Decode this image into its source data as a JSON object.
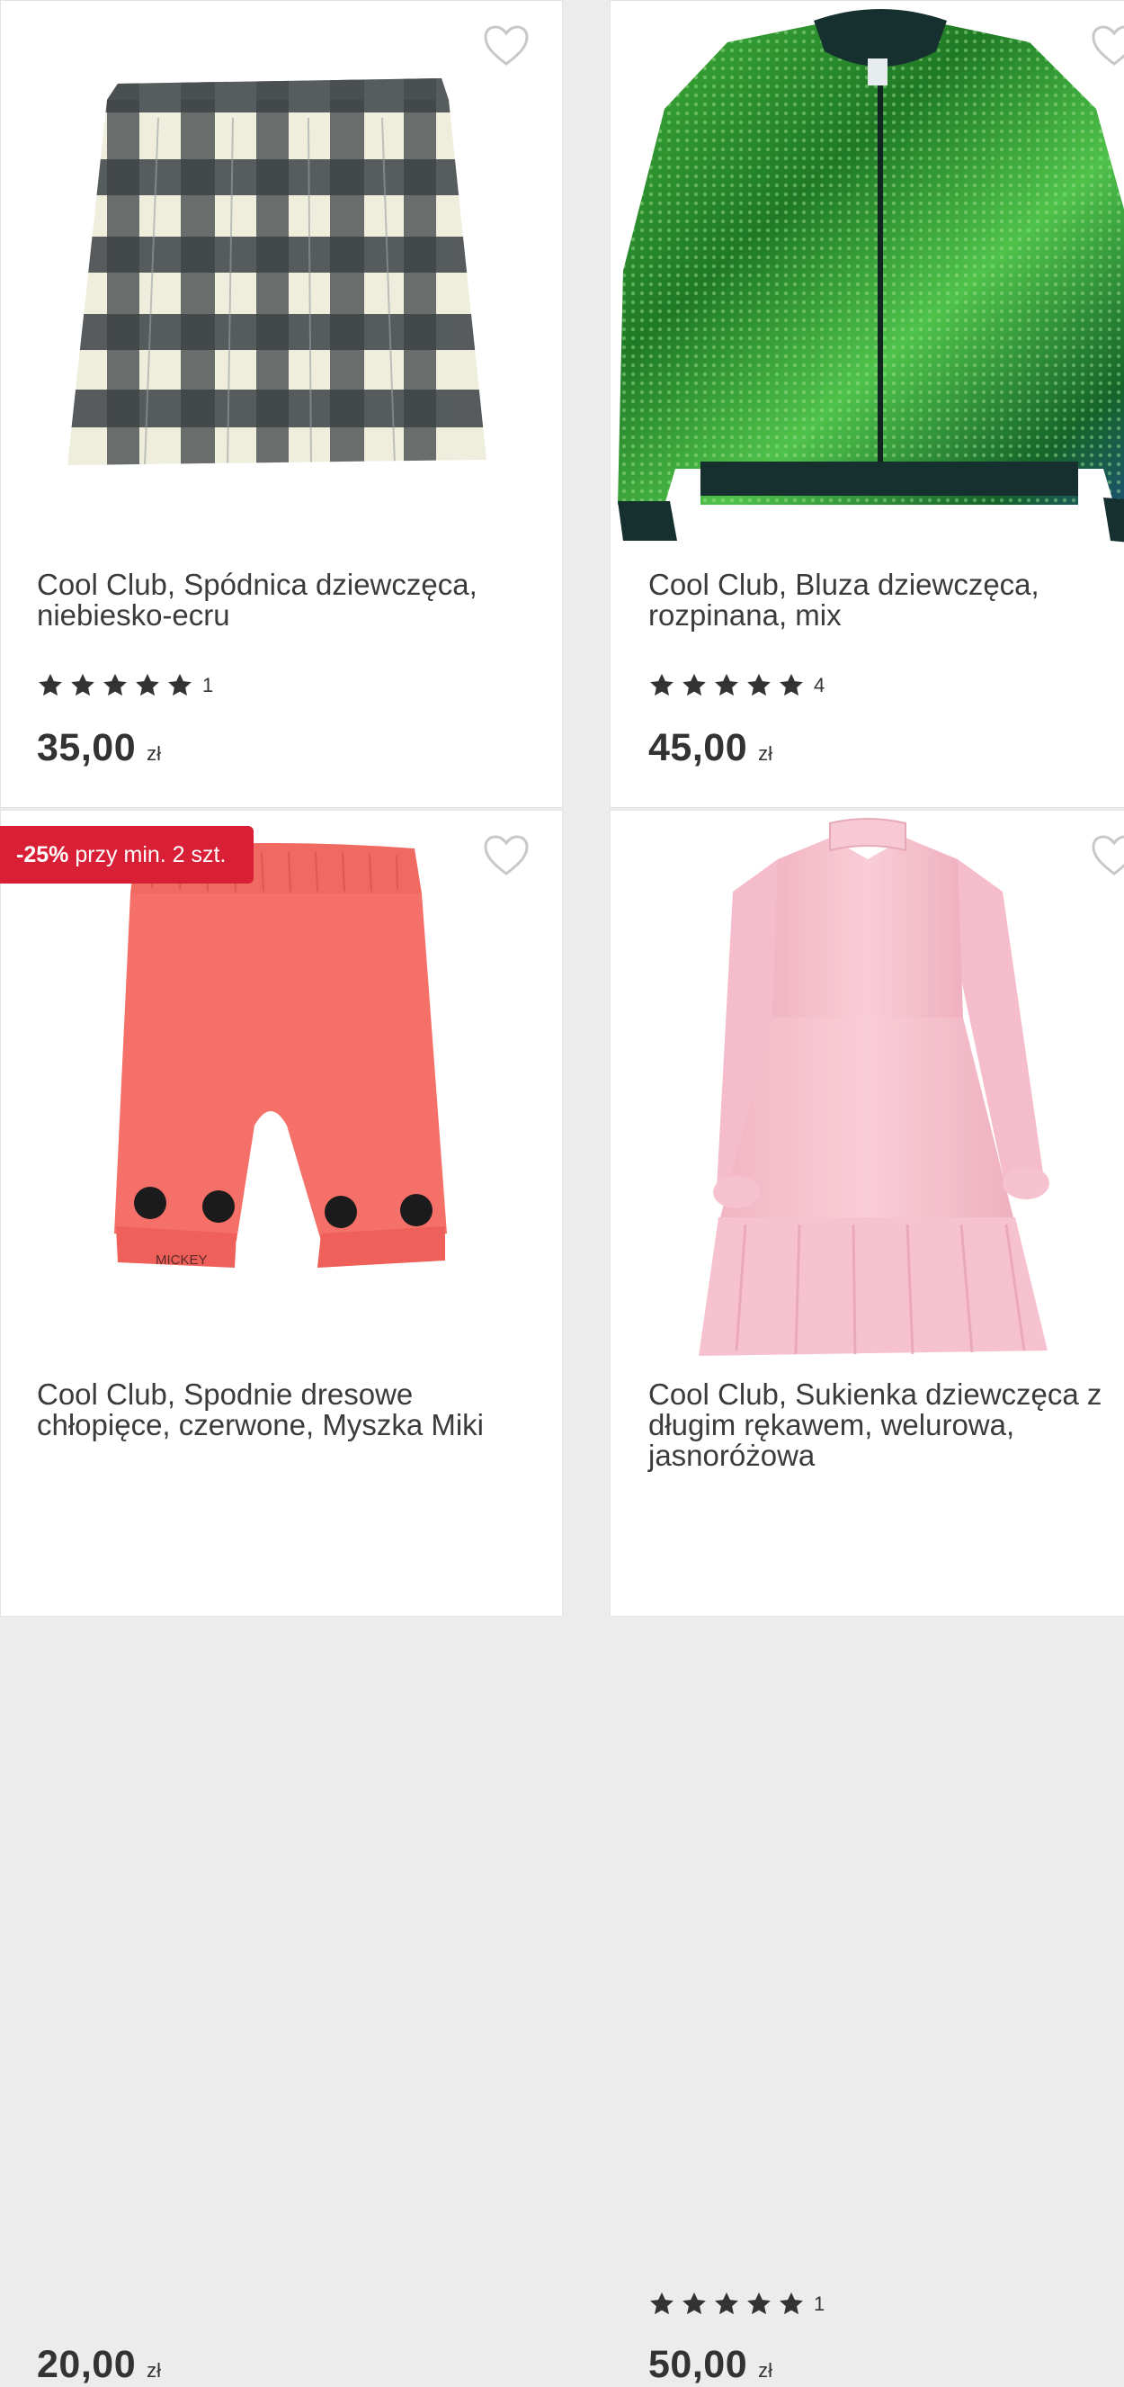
{
  "products": [
    {
      "title": "Cool Club, Spódnica dziewczęca, niebiesko-ecru",
      "rating_count": "1",
      "rating_stars": 5,
      "price": "35,00",
      "currency": "zł",
      "image_icon": "plaid-skirt-image"
    },
    {
      "title": "Cool Club, Bluza dziewczęca, rozpinana, mix",
      "rating_count": "4",
      "rating_stars": 5,
      "price": "45,00",
      "currency": "zł",
      "image_icon": "green-sequin-jacket-image"
    },
    {
      "title": "Cool Club, Spodnie dresowe chłopięce, czerwone, Myszka Miki",
      "promo_percent": "-25%",
      "promo_rest": " przy min. 2 szt.",
      "print_text": "MICKEY",
      "price": "20,00",
      "currency": "zł",
      "image_icon": "red-sweatpants-image"
    },
    {
      "title": "Cool Club, Sukienka dziewczęca z długim rękawem, welurowa, jasnoróżowa",
      "rating_count": "1",
      "rating_stars": 5,
      "price": "50,00",
      "currency": "zł",
      "image_icon": "pink-dress-image"
    }
  ],
  "colors": {
    "promo_bg": "#d81f35",
    "star": "#333333",
    "heart_outline": "#c8c8c8"
  }
}
